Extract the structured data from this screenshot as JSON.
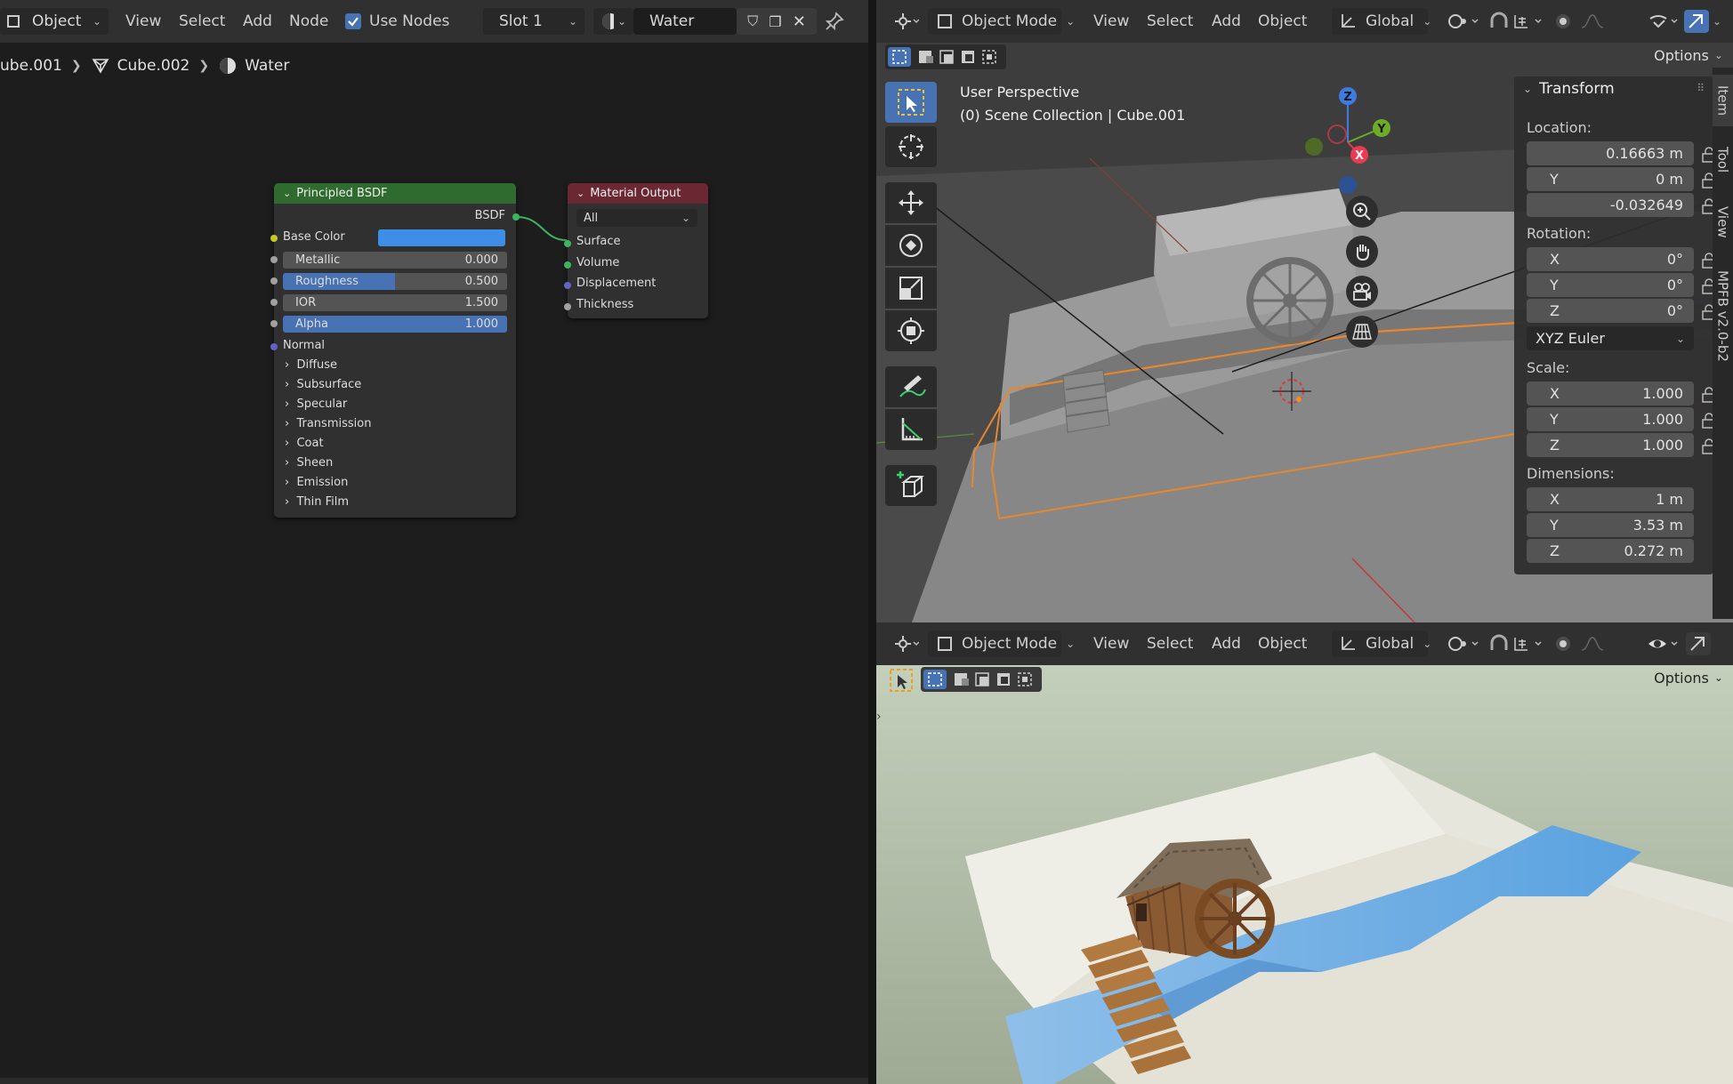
{
  "node_header": {
    "mode_label": "Object",
    "menu": [
      "View",
      "Select",
      "Add",
      "Node"
    ],
    "use_nodes_label": "Use Nodes",
    "slot_label": "Slot 1",
    "material_name": "Water"
  },
  "breadcrumb": {
    "object": "ube.001",
    "mesh": "Cube.002",
    "material": "Water"
  },
  "bsdf_node": {
    "title": "Principled BSDF",
    "output_label": "BSDF",
    "base_color_label": "Base Color",
    "base_color": "#3e8ee8",
    "sliders": [
      {
        "label": "Metallic",
        "value": "0.000",
        "fraction": 0.0
      },
      {
        "label": "Roughness",
        "value": "0.500",
        "fraction": 0.5
      },
      {
        "label": "IOR",
        "value": "1.500",
        "fraction": 0.0
      },
      {
        "label": "Alpha",
        "value": "1.000",
        "fraction": 1.0
      }
    ],
    "normal_label": "Normal",
    "panels": [
      "Diffuse",
      "Subsurface",
      "Specular",
      "Transmission",
      "Coat",
      "Sheen",
      "Emission",
      "Thin Film"
    ]
  },
  "output_node": {
    "title": "Material Output",
    "target": "All",
    "inputs": [
      "Surface",
      "Volume",
      "Displacement",
      "Thickness"
    ]
  },
  "viewport_header": {
    "mode": "Object Mode",
    "menu": [
      "View",
      "Select",
      "Add",
      "Object"
    ],
    "orientation": "Global",
    "options_label": "Options"
  },
  "viewport_overlay": {
    "perspective": "User Perspective",
    "collection": "(0) Scene Collection | Cube.001"
  },
  "gizmo": {
    "x": "X",
    "y": "Y",
    "z": "Z"
  },
  "transform_panel": {
    "title": "Transform",
    "location_label": "Location:",
    "location": [
      "0.16663 m",
      "0 m",
      "-0.032649"
    ],
    "rotation_label": "Rotation:",
    "rotation": [
      "0°",
      "0°",
      "0°"
    ],
    "rotation_mode": "XYZ Euler",
    "scale_label": "Scale:",
    "scale": [
      "1.000",
      "1.000",
      "1.000"
    ],
    "dimensions_label": "Dimensions:",
    "dimensions": [
      "1 m",
      "3.53 m",
      "0.272 m"
    ],
    "axis": [
      "X",
      "Y",
      "Z"
    ]
  },
  "sidebar_tabs": [
    "Item",
    "Tool",
    "View",
    "MPFB v2.0-b2"
  ],
  "colors": {
    "bsdf_header": "#2f6b2f",
    "output_header": "#6b2832",
    "accent": "#4772b3",
    "selection": "#f0922c"
  }
}
